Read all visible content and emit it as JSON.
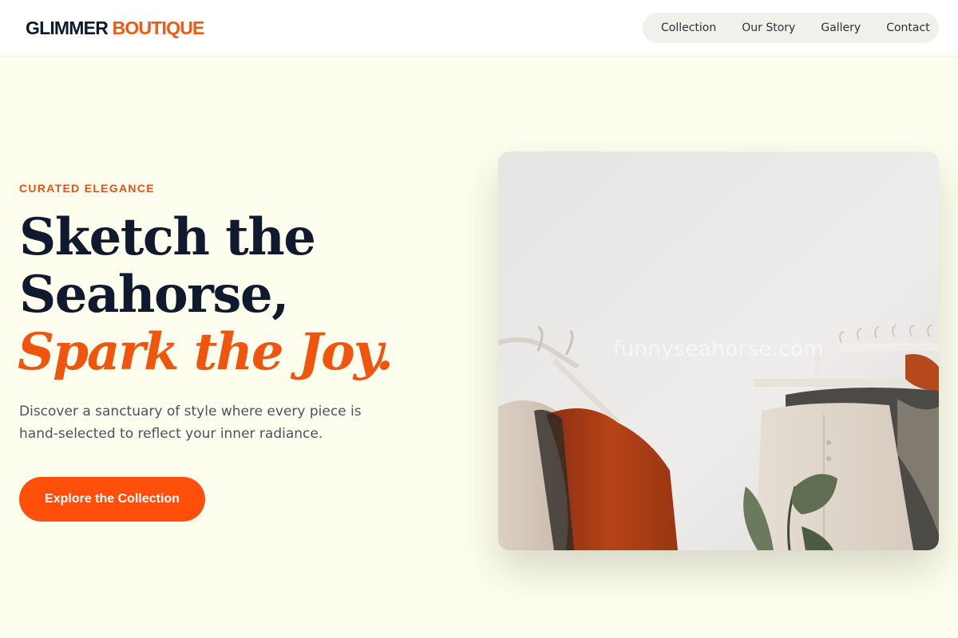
{
  "brand": {
    "name_primary": "GLIMMER",
    "name_accent": "BOUTIQUE"
  },
  "nav": {
    "items": [
      {
        "label": "Collection"
      },
      {
        "label": "Our Story"
      },
      {
        "label": "Gallery"
      },
      {
        "label": "Contact"
      }
    ]
  },
  "hero": {
    "eyebrow": "CURATED ELEGANCE",
    "headline_line1": "Sketch the",
    "headline_line2": "Seahorse,",
    "headline_accent": "Spark the Joy.",
    "description": "Discover a sanctuary of style where every piece is hand-selected to reflect your inner radiance.",
    "cta_label": "Explore the Collection",
    "image_watermark": "funnyseahorse.com"
  },
  "colors": {
    "accent": "#ff4f0a",
    "accent_text": "#e05514",
    "heading": "#0f1a2e",
    "page_background": "#fefeee"
  }
}
